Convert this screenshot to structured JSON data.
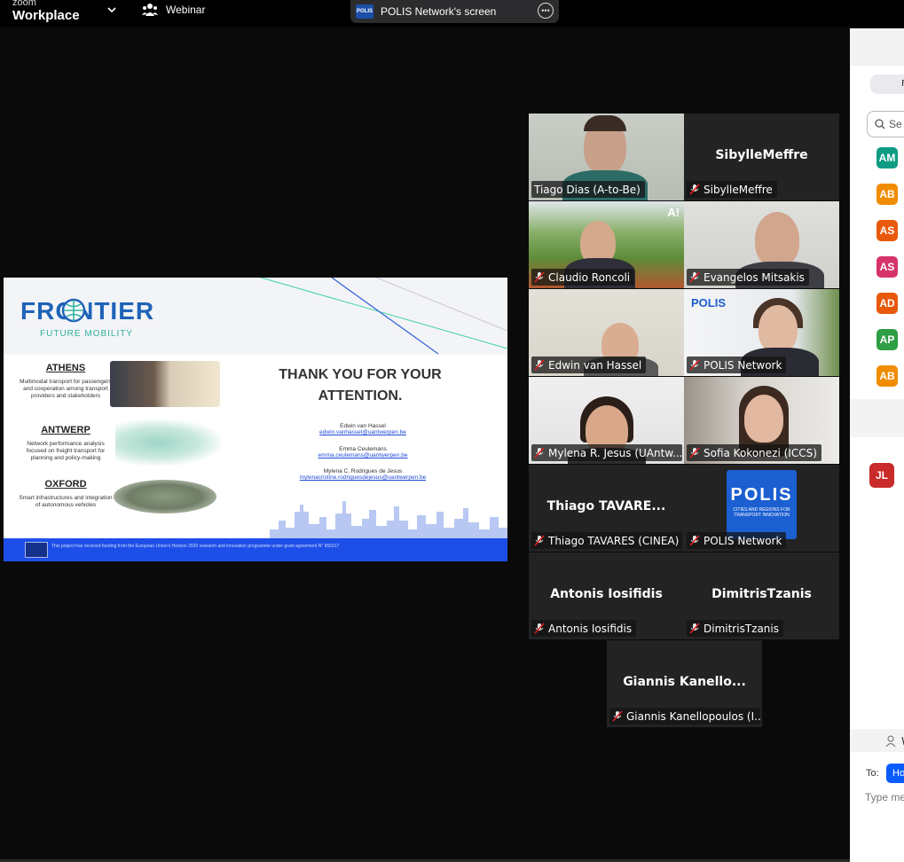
{
  "app": {
    "brand_top": "zoom",
    "brand_bottom": "Workplace",
    "mode_label": "Webinar"
  },
  "share": {
    "label": "POLIS Network's screen",
    "logo_text": "POLIS"
  },
  "slide": {
    "title": "FRONTIER",
    "subtitle": "FUTURE MOBILITY",
    "cities": [
      {
        "name": "ATHENS",
        "desc": "Multimodal transport for passengers and cooperation among transport providers and stakeholders"
      },
      {
        "name": "ANTWERP",
        "desc": "Network performance analysis focused on freight transport for planning and policy-making"
      },
      {
        "name": "OXFORD",
        "desc": "Smart infrastructures and integration of autonomous vehicles"
      }
    ],
    "thanks": "THANK YOU FOR YOUR ATTENTION.",
    "authors": [
      {
        "name": "Edwin van Hassel",
        "email": "edwin.vanhassel@uantwerpen.be"
      },
      {
        "name": "Emma Ceulemans",
        "email": "emma.ceulemans@uantwerpen.be"
      },
      {
        "name": "Mylena C. Rodrigues de Jesus",
        "email": "mylenacristine.rodriguesdejesus@uantwerpen.be"
      }
    ],
    "footer": "This project has received funding from the European Union's Horizon 2020 research and innovation programme under grant agreement N° 955317"
  },
  "tiles": [
    {
      "label": "Tiago Dias (A-to-Be)",
      "big": ""
    },
    {
      "label": "SibylleMeffre",
      "big": "SibylleMeffre"
    },
    {
      "label": "Claudio Roncoli",
      "big": "",
      "badge": "A!"
    },
    {
      "label": "Evangelos Mitsakis",
      "big": ""
    },
    {
      "label": "Edwin van Hassel",
      "big": ""
    },
    {
      "label": "POLIS Network",
      "big": "",
      "logo": "POLIS"
    },
    {
      "label": "Mylena R. Jesus (UAntw...",
      "big": ""
    },
    {
      "label": "Sofia Kokonezi (ICCS)",
      "big": ""
    },
    {
      "label": "Thiago TAVARES (CINEA)",
      "big": "Thiago  TAVARE..."
    },
    {
      "label": "POLIS Network",
      "big": "",
      "logo_big": "POLIS",
      "logo_small": "CITIES AND REGIONS FOR TRANSPORT INNOVATION"
    },
    {
      "label": "Antonis Iosifidis",
      "big": "Antonis Iosifidis"
    },
    {
      "label": "DimitrisTzanis",
      "big": "DimitrisTzanis"
    },
    {
      "label": "Giannis Kanellopoulos (I...",
      "big": "Giannis  Kanello..."
    }
  ],
  "panel": {
    "pill": "F",
    "search": "Se",
    "avatars": [
      {
        "initials": "AM",
        "color": "#0e9c84"
      },
      {
        "initials": "AB",
        "color": "#f08c00"
      },
      {
        "initials": "AS",
        "color": "#e8590c"
      },
      {
        "initials": "AS",
        "color": "#d6336c"
      },
      {
        "initials": "AD",
        "color": "#e8590c"
      },
      {
        "initials": "AP",
        "color": "#2f9e44"
      },
      {
        "initials": "AB",
        "color": "#f08c00"
      }
    ],
    "chat_avatar": {
      "initials": "JL",
      "color": "#c92a2a"
    },
    "w_text": "W",
    "to_label": "To:",
    "to_value": "Ho",
    "type_placeholder": "Type me"
  }
}
